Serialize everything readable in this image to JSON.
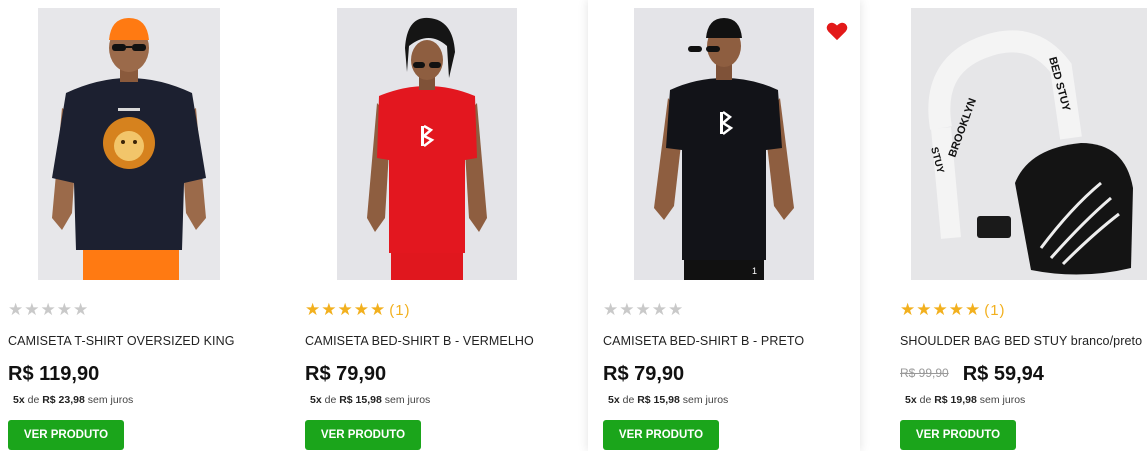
{
  "colors": {
    "button_green": "#1ba51b",
    "star_gold": "#f2b01e",
    "star_grey": "#c9c9c9",
    "heart_red": "#e31919"
  },
  "products": [
    {
      "image_icon": "model-black-lion-tshirt-photo",
      "stars_filled": 0,
      "stars_empty": "★★★★★",
      "stars_on": "",
      "rating_count": "",
      "title": "CAMISETA T-SHIRT OVERSIZED KING",
      "variant": "",
      "old_price": "",
      "price": "R$ 119,90",
      "installments": "5x",
      "installment_de": "de",
      "installment_value": "R$ 23,98",
      "installment_suffix": "sem juros",
      "button": "VER PRODUTO",
      "favorited": false
    },
    {
      "image_icon": "model-red-shirt-photo",
      "stars_filled": 5,
      "stars_empty": "",
      "stars_on": "★★★★★",
      "rating_count": "(1)",
      "title": "CAMISETA BED-SHIRT B - VERMELHO",
      "variant": "",
      "old_price": "",
      "price": "R$ 79,90",
      "installments": "5x",
      "installment_de": "de",
      "installment_value": "R$ 15,98",
      "installment_suffix": "sem juros",
      "button": "VER PRODUTO",
      "favorited": false
    },
    {
      "image_icon": "model-black-shirt-photo",
      "stars_filled": 0,
      "stars_empty": "★★★★★",
      "stars_on": "",
      "rating_count": "",
      "title": "CAMISETA BED-SHIRT B - PRETO",
      "variant": "",
      "old_price": "",
      "price": "R$ 79,90",
      "installments": "5x",
      "installment_de": "de",
      "installment_value": "R$ 15,98",
      "installment_suffix": "sem juros",
      "button": "VER PRODUTO",
      "favorited": true
    },
    {
      "image_icon": "shoulder-bag-photo",
      "stars_filled": 5,
      "stars_empty": "",
      "stars_on": "★★★★★",
      "rating_count": "(1)",
      "title": "SHOULDER BAG BED STUY",
      "variant": " branco/preto",
      "old_price": "R$ 99,90",
      "price": "R$ 59,94",
      "installments": "5x",
      "installment_de": "de",
      "installment_value": "R$ 19,98",
      "installment_suffix": "sem juros",
      "button": "VER PRODUTO",
      "favorited": false,
      "bag_strap_text_1": "BROOKLYN",
      "bag_strap_text_2": "BED STUY",
      "bag_strap_text_3": "STUY"
    }
  ]
}
